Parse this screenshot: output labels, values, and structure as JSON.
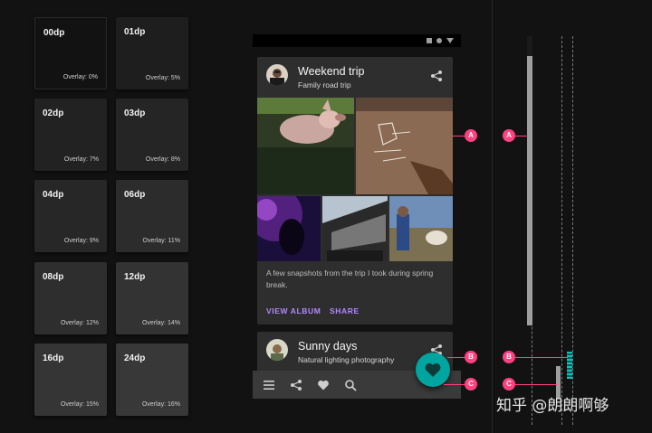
{
  "elevation_tiles": [
    {
      "dp": "00dp",
      "overlay": "Overlay: 0%",
      "color": "#121212"
    },
    {
      "dp": "01dp",
      "overlay": "Overlay: 5%",
      "color": "#1e1e1e"
    },
    {
      "dp": "02dp",
      "overlay": "Overlay: 7%",
      "color": "#222222"
    },
    {
      "dp": "03dp",
      "overlay": "Overlay: 8%",
      "color": "#252525"
    },
    {
      "dp": "04dp",
      "overlay": "Overlay: 9%",
      "color": "#272727"
    },
    {
      "dp": "06dp",
      "overlay": "Overlay: 11%",
      "color": "#2c2c2c"
    },
    {
      "dp": "08dp",
      "overlay": "Overlay: 12%",
      "color": "#2e2e2e"
    },
    {
      "dp": "12dp",
      "overlay": "Overlay: 14%",
      "color": "#333333"
    },
    {
      "dp": "16dp",
      "overlay": "Overlay: 15%",
      "color": "#353535"
    },
    {
      "dp": "24dp",
      "overlay": "Overlay: 16%",
      "color": "#383838"
    }
  ],
  "card1": {
    "title": "Weekend trip",
    "subtitle": "Family road trip",
    "body": "A few snapshots from the trip I took during spring break.",
    "action_primary": "VIEW ALBUM",
    "action_secondary": "SHARE",
    "share_icon": "share-icon"
  },
  "card2": {
    "title": "Sunny days",
    "subtitle": "Natural lighting photography",
    "share_icon": "share-icon"
  },
  "bottom_bar": {
    "icons": [
      "menu-icon",
      "share-icon",
      "heart-icon",
      "search-icon"
    ],
    "fab_icon": "heart-icon",
    "fab_color": "#00a5a0"
  },
  "callouts": {
    "a_left": "A",
    "a_right": "A",
    "b_left": "B",
    "b_right": "B",
    "c_left": "C",
    "c_right": "C",
    "color": "#ff4081"
  },
  "watermark": "知乎 @朗朗啊够"
}
